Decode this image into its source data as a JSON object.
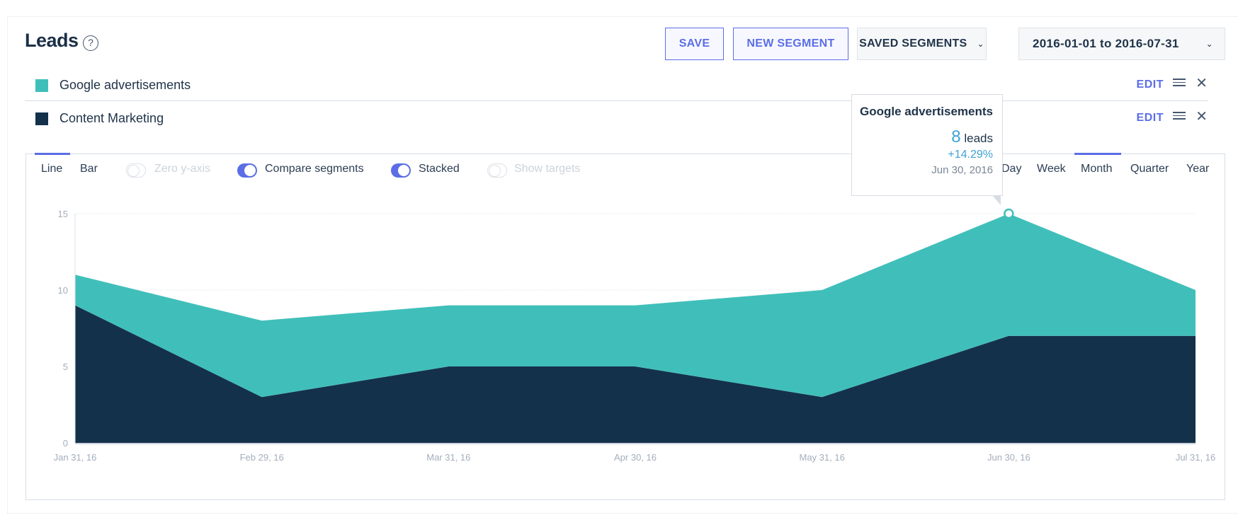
{
  "header": {
    "title": "Leads",
    "help_icon": "?",
    "save_label": "SAVE",
    "new_segment_label": "NEW SEGMENT",
    "saved_segments_label": "SAVED SEGMENTS",
    "date_range": "2016-01-01 to 2016-07-31",
    "chevron": "⌄"
  },
  "segments": [
    {
      "label": "Google advertisements",
      "color": "#40bfba",
      "edit_label": "EDIT",
      "close": "✕"
    },
    {
      "label": "Content Marketing",
      "color": "#14314b",
      "edit_label": "EDIT",
      "close": "✕"
    }
  ],
  "controls": {
    "chart_types": [
      "Line",
      "Bar"
    ],
    "active_chart_type": "Line",
    "toggles": [
      {
        "label": "Zero y-axis",
        "on": false
      },
      {
        "label": "Compare segments",
        "on": true
      },
      {
        "label": "Stacked",
        "on": true
      },
      {
        "label": "Show targets",
        "on": false
      }
    ],
    "periods": [
      "Day",
      "Week",
      "Month",
      "Quarter",
      "Year"
    ],
    "active_period": "Month"
  },
  "tooltip": {
    "title": "Google advertisements",
    "value": "8",
    "unit": "leads",
    "change": "+14.29%",
    "date": "Jun 30, 2016"
  },
  "chart_data": {
    "type": "area",
    "stacked": true,
    "title": "Leads",
    "xlabel": "",
    "ylabel": "",
    "categories": [
      "Jan 31, 16",
      "Feb 29, 16",
      "Mar 31, 16",
      "Apr 30, 16",
      "May 31, 16",
      "Jun 30, 16",
      "Jul 31, 16"
    ],
    "series": [
      {
        "name": "Content Marketing",
        "color": "#14314b",
        "values": [
          9,
          3,
          5,
          5,
          3,
          7,
          7
        ]
      },
      {
        "name": "Google advertisements",
        "color": "#40bfba",
        "values": [
          2,
          5,
          4,
          4,
          7,
          8,
          3
        ]
      }
    ],
    "yticks": [
      0,
      5,
      10,
      15
    ],
    "ylim": [
      0,
      15
    ],
    "grid": true,
    "highlight": {
      "series": "Google advertisements",
      "category": "Jun 30, 16"
    }
  }
}
